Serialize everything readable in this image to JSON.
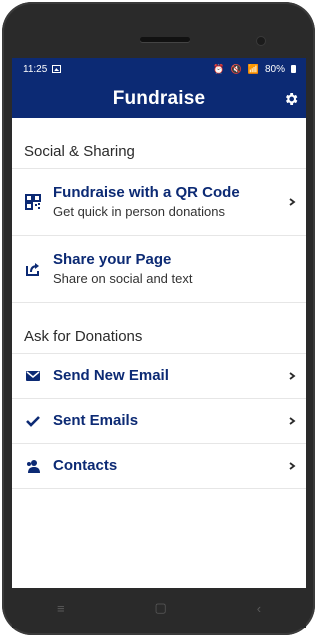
{
  "status": {
    "time": "11:25",
    "battery": "80%"
  },
  "appbar": {
    "title": "Fundraise"
  },
  "sections": {
    "social": {
      "header": "Social & Sharing",
      "items": [
        {
          "title": "Fundraise with a QR Code",
          "subtitle": "Get quick in person donations"
        },
        {
          "title": "Share your Page",
          "subtitle": "Share on social and text"
        }
      ]
    },
    "ask": {
      "header": "Ask for Donations",
      "items": [
        {
          "title": "Send New Email"
        },
        {
          "title": "Sent Emails"
        },
        {
          "title": "Contacts"
        }
      ]
    }
  },
  "navbar": {
    "recent": "≡",
    "home": "▢",
    "back": "‹"
  },
  "colors": {
    "brand": "#0c2a74",
    "text": "#2b2b2b"
  }
}
